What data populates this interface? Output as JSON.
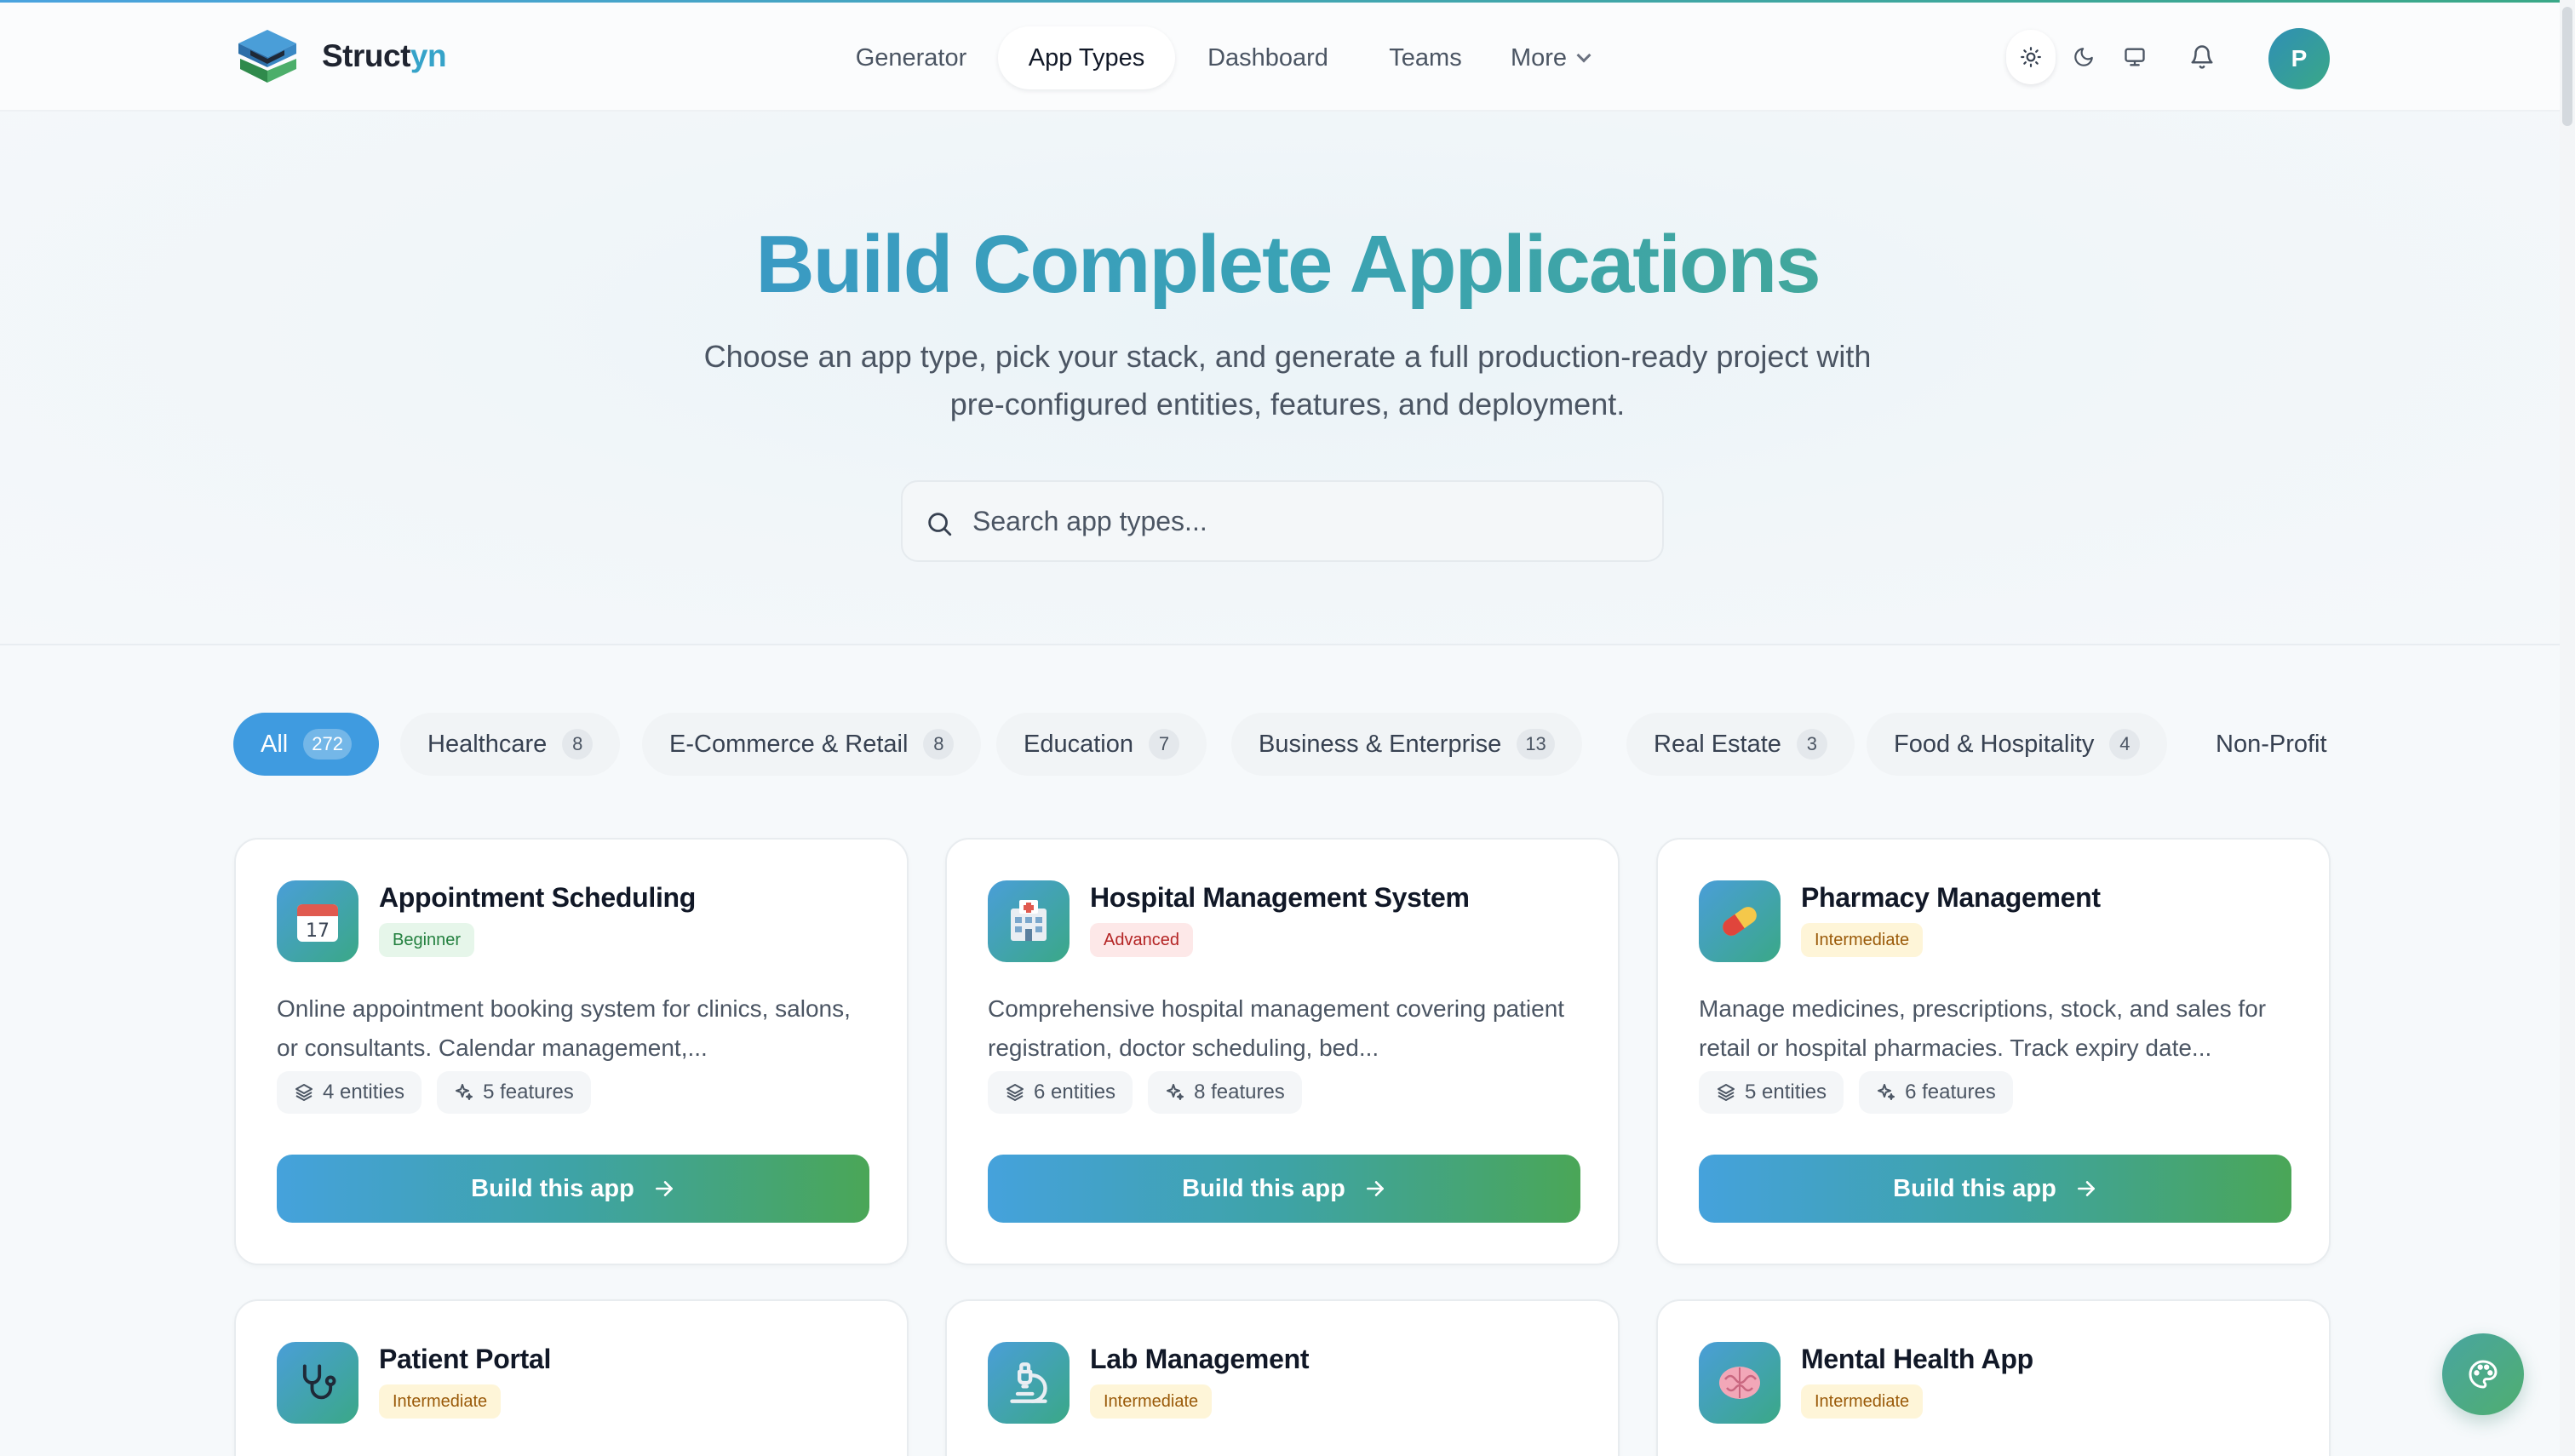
{
  "brand": {
    "part1": "Struct",
    "part2": "yn"
  },
  "nav": {
    "items": [
      "Generator",
      "App Types",
      "Dashboard",
      "Teams"
    ],
    "more_label": "More",
    "active": "App Types"
  },
  "header_icons": [
    "sun-icon",
    "moon-icon",
    "monitor-icon",
    "bell-icon"
  ],
  "user": {
    "avatar_initial": "P"
  },
  "hero": {
    "title": "Build Complete Applications",
    "subtitle": "Choose an app type, pick your stack, and generate a full production-ready project with pre-configured entities, features, and deployment."
  },
  "search": {
    "placeholder": "Search app types..."
  },
  "categories": [
    {
      "label": "All",
      "count": "272"
    },
    {
      "label": "Healthcare",
      "count": "8"
    },
    {
      "label": "E-Commerce & Retail",
      "count": "8"
    },
    {
      "label": "Education",
      "count": "7"
    },
    {
      "label": "Business & Enterprise",
      "count": "13"
    },
    {
      "label": "Real Estate",
      "count": "3"
    },
    {
      "label": "Food & Hospitality",
      "count": "4"
    },
    {
      "label": "Non-Profit &",
      "count": ""
    }
  ],
  "colors": {
    "accent_blue": "#3f9be0",
    "accent_green": "#4aa657",
    "beginner": "#23803f",
    "advanced": "#b42424",
    "intermediate": "#9a5a09"
  },
  "cards": [
    {
      "title": "Appointment Scheduling",
      "level": "Beginner",
      "icon": "calendar-icon",
      "icon_text": "17",
      "description": "Online appointment booking system for clinics, salons, or consultants. Calendar management,...",
      "entities": "4 entities",
      "features": "5 features",
      "button": "Build this app"
    },
    {
      "title": "Hospital Management System",
      "level": "Advanced",
      "icon": "hospital-icon",
      "description": "Comprehensive hospital management covering patient registration, doctor scheduling, bed...",
      "entities": "6 entities",
      "features": "8 features",
      "button": "Build this app"
    },
    {
      "title": "Pharmacy Management",
      "level": "Intermediate",
      "icon": "pill-icon",
      "description": "Manage medicines, prescriptions, stock, and sales for retail or hospital pharmacies. Track expiry date...",
      "entities": "5 entities",
      "features": "6 features",
      "button": "Build this app"
    },
    {
      "title": "Patient Portal",
      "level": "Intermediate",
      "icon": "stethoscope-icon"
    },
    {
      "title": "Lab Management",
      "level": "Intermediate",
      "icon": "microscope-icon"
    },
    {
      "title": "Mental Health App",
      "level": "Intermediate",
      "icon": "brain-icon"
    }
  ]
}
